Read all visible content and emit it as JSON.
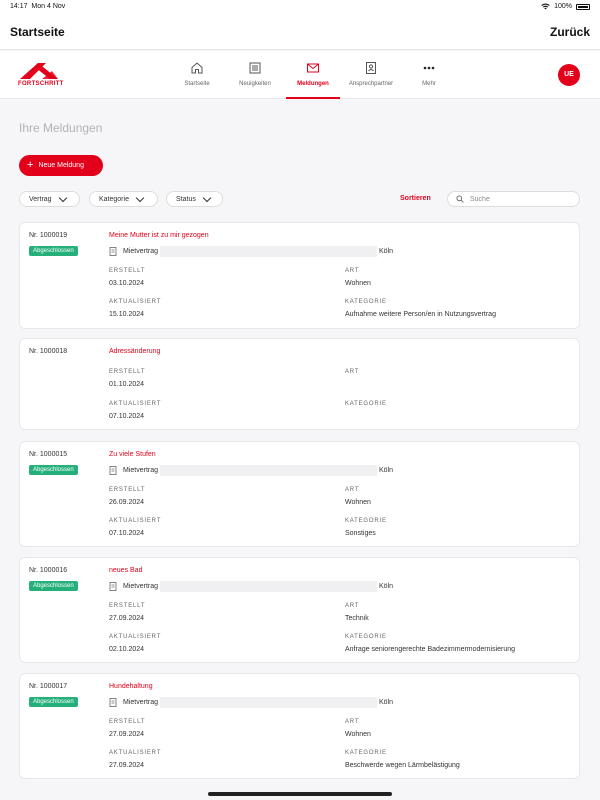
{
  "status_bar": {
    "time": "14:17",
    "date": "Mon 4 Nov",
    "battery": "100%"
  },
  "nav": {
    "title": "Startseite",
    "back_label": "Zurück"
  },
  "brand": {
    "name": "FORTSCHRITT",
    "color": "#e2001a"
  },
  "tabs": [
    {
      "label": "Startseite",
      "icon": "home-icon",
      "active": false
    },
    {
      "label": "Neuigkeiten",
      "icon": "newspaper-icon",
      "active": false
    },
    {
      "label": "Meldungen",
      "icon": "mail-icon",
      "active": true
    },
    {
      "label": "Ansprechpartner",
      "icon": "contact-book-icon",
      "active": false
    },
    {
      "label": "Mehr",
      "icon": "more-icon",
      "active": false
    }
  ],
  "user": {
    "initials": "UE"
  },
  "page": {
    "title": "Ihre Meldungen"
  },
  "actions": {
    "new_label": "Neue Meldung"
  },
  "filters": {
    "vertrag": "Vertrag",
    "kategorie": "Kategorie",
    "status": "Status",
    "sort": "Sortieren",
    "search_placeholder": "Suche"
  },
  "labels": {
    "erstellt": "ERSTELLT",
    "aktualisiert": "AKTUALISIERT",
    "art": "ART",
    "kategorie": "KATEGORIE"
  },
  "colors": {
    "accent": "#e2001a",
    "badge": "#25b07a"
  },
  "cards": [
    {
      "nr": "Nr. 1000019",
      "badge": "Abgeschlossen",
      "title": "Meine Mutter ist zu mir gezogen",
      "contract": "Mietvertrag",
      "city": "Köln",
      "erstellt": "03.10.2024",
      "aktualisiert": "15.10.2024",
      "art": "Wohnen",
      "kategorie": "Aufnahme weitere Person/en in Nutzungsvertrag"
    },
    {
      "nr": "Nr. 1000018",
      "badge": "",
      "title": "Adressänderung",
      "contract": "",
      "city": "",
      "erstellt": "01.10.2024",
      "aktualisiert": "07.10.2024",
      "art": "",
      "kategorie": ""
    },
    {
      "nr": "Nr. 1000015",
      "badge": "Abgeschlossen",
      "title": "Zu viele Stufen",
      "contract": "Mietvertrag",
      "city": "Köln",
      "erstellt": "26.09.2024",
      "aktualisiert": "07.10.2024",
      "art": "Wohnen",
      "kategorie": "Sonstiges"
    },
    {
      "nr": "Nr. 1000016",
      "badge": "Abgeschlossen",
      "title": "neues Bad",
      "contract": "Mietvertrag",
      "city": "Köln",
      "erstellt": "27.09.2024",
      "aktualisiert": "02.10.2024",
      "art": "Technik",
      "kategorie": "Anfrage seniorengerechte Badezimmermodernisierung"
    },
    {
      "nr": "Nr. 1000017",
      "badge": "Abgeschlossen",
      "title": "Hundehaltung",
      "contract": "Mietvertrag",
      "city": "Köln",
      "erstellt": "27.09.2024",
      "aktualisiert": "27.09.2024",
      "art": "Wohnen",
      "kategorie": "Beschwerde wegen Lärmbelästigung"
    }
  ]
}
